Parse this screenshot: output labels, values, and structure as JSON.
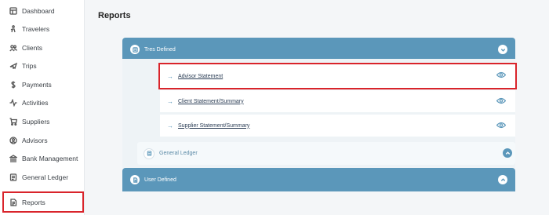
{
  "sidebar": {
    "items": [
      {
        "label": "Dashboard",
        "icon": "dashboard-icon"
      },
      {
        "label": "Travelers",
        "icon": "travelers-icon"
      },
      {
        "label": "Clients",
        "icon": "clients-icon"
      },
      {
        "label": "Trips",
        "icon": "trips-icon"
      },
      {
        "label": "Payments",
        "icon": "dollar-icon"
      },
      {
        "label": "Activities",
        "icon": "activity-icon"
      },
      {
        "label": "Suppliers",
        "icon": "cart-icon"
      },
      {
        "label": "Advisors",
        "icon": "advisors-icon"
      },
      {
        "label": "Bank Management",
        "icon": "bank-icon"
      },
      {
        "label": "General Ledger",
        "icon": "ledger-icon"
      },
      {
        "label": "Reports",
        "icon": "report-icon"
      }
    ],
    "active": "Reports"
  },
  "main": {
    "title": "Reports",
    "sections": {
      "tres_defined": {
        "label": "Tres Defined",
        "reports": [
          {
            "label": "Advisor Statement"
          },
          {
            "label": "Client Statement/Summary"
          },
          {
            "label": "Supplier Statement/Summary"
          }
        ],
        "sub_group": {
          "label": "General Ledger"
        }
      },
      "user_defined": {
        "label": "User Defined"
      }
    }
  },
  "colors": {
    "accent": "#5b97ba",
    "highlight": "#d9242b"
  }
}
